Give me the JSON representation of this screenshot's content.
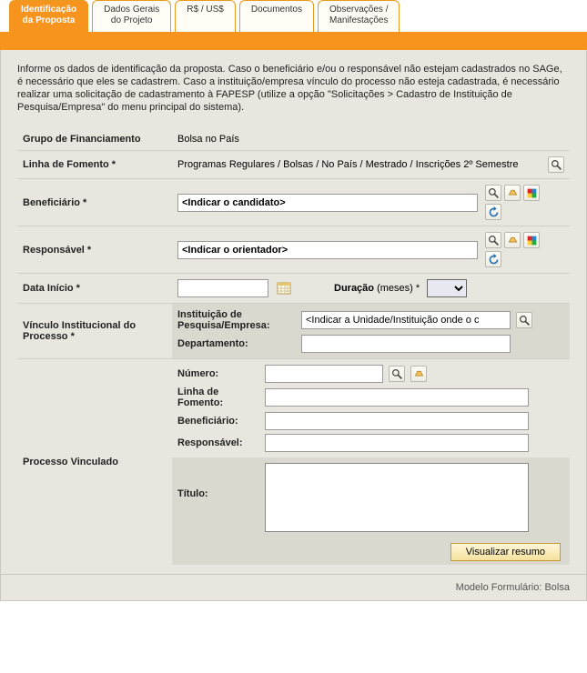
{
  "tabs": {
    "t0": "Identificação\nda Proposta",
    "t1": "Dados Gerais\ndo Projeto",
    "t2": "R$ / US$",
    "t3": "Documentos",
    "t4": "Observações /\nManifestações"
  },
  "intro": "Informe os dados de identificação da proposta. Caso o beneficiário e/ou o responsável não estejam cadastrados no SAGe, é necessário que eles se cadastrem. Caso a instituição/empresa vínculo do processo não esteja cadastrada, é necessário realizar uma solicitação de cadastramento à FAPESP (utilize a opção \"Solicitações > Cadastro de Instituição de Pesquisa/Empresa\" do menu principal do sistema).",
  "labels": {
    "grupo": "Grupo de Financiamento",
    "linha": "Linha de Fomento *",
    "benef": "Beneficiário *",
    "resp": "Responsável *",
    "data": "Data Início *",
    "duracao": "Duração",
    "duracao_unit": "(meses) *",
    "vinculo": "Vínculo Institucional do Processo *",
    "inst": "Instituição de Pesquisa/Empresa:",
    "depto": "Departamento:",
    "proc": "Processo Vinculado",
    "numero": "Número:",
    "pv_linha": "Linha de Fomento:",
    "pv_benef": "Beneficiário:",
    "pv_resp": "Responsável:",
    "pv_titulo": "Título:",
    "btn_resume": "Visualizar resumo",
    "footer": "Modelo Formulário: Bolsa"
  },
  "values": {
    "grupo": "Bolsa no País",
    "linha": "Programas Regulares / Bolsas / No País / Mestrado / Inscrições 2º Semestre",
    "benef_placeholder": "<Indicar o candidato>",
    "resp_placeholder": "<Indicar o orientador>",
    "inst_placeholder": "<Indicar a Unidade/Instituição onde o c",
    "data": "",
    "depto": "",
    "numero": "",
    "pv_linha": "",
    "pv_benef": "",
    "pv_resp": "",
    "pv_titulo": ""
  }
}
